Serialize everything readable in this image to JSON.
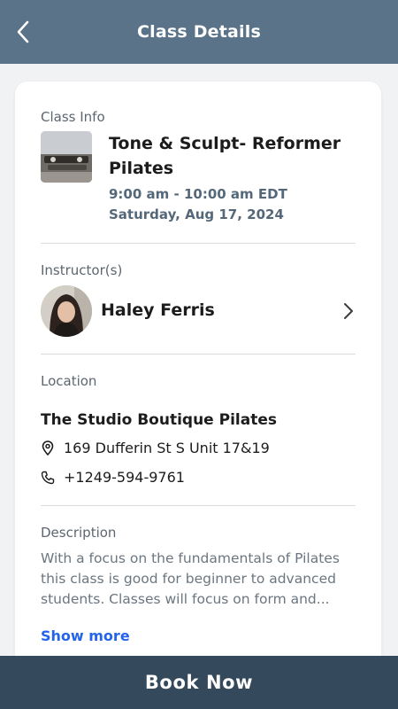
{
  "header": {
    "title": "Class Details",
    "back_icon": "chevron-left-icon"
  },
  "class_info": {
    "section_label": "Class Info",
    "title": "Tone & Sculpt- Reformer Pilates",
    "time": "9:00 am - 10:00 am EDT",
    "date": "Saturday, Aug 17, 2024"
  },
  "instructor": {
    "section_label": "Instructor(s)",
    "name": "Haley Ferris",
    "chevron_icon": "chevron-right-icon"
  },
  "location": {
    "section_label": "Location",
    "name": "The Studio Boutique Pilates",
    "address": "169 Dufferin St S Unit 17&19",
    "phone": "+1249-594-9761",
    "address_icon": "map-pin-icon",
    "phone_icon": "phone-icon"
  },
  "description": {
    "section_label": "Description",
    "text": "With a focus on the fundamentals of Pilates this class is good for beginner to advanced students. Classes will focus on form and...",
    "show_more_label": "Show more"
  },
  "footer": {
    "book_label": "Book Now"
  },
  "colors": {
    "header_bg": "#5a7389",
    "book_bar_bg": "#35495c",
    "link": "#2563eb",
    "meta_text": "#55687a"
  }
}
